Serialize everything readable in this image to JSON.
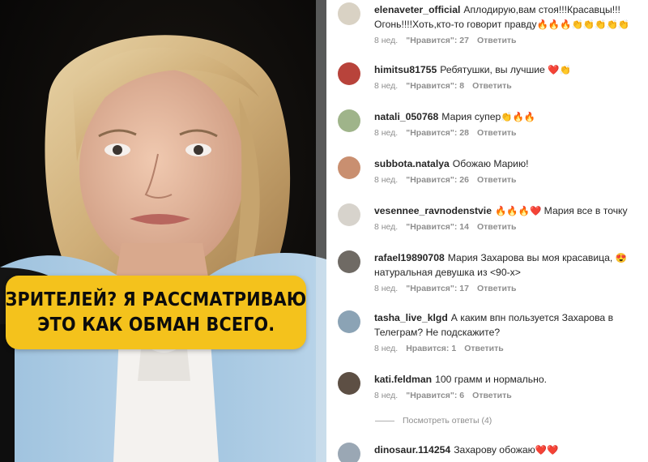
{
  "caption": {
    "line1": "ЗРИТЕЛЕЙ? Я РАССМАТРИВАЮ",
    "line2": "ЭТО КАК ОБМАН ВСЕГО."
  },
  "comments": [
    {
      "username": "elenaveter_official",
      "text": "Аплодирую,вам стоя!!!Красавцы!!! Огонь!!!!Хоть,кто-то говорит правду",
      "emoji": "🔥🔥🔥👏👏👏👏👏",
      "time": "8 нед.",
      "likes": "\"Нравится\": 27",
      "reply": "Ответить",
      "avatar_color": "#d9d2c4"
    },
    {
      "username": "himitsu81755",
      "text": "Ребятушки, вы лучшие",
      "emoji": "❤️👏",
      "time": "8 нед.",
      "likes": "\"Нравится\": 8",
      "reply": "Ответить",
      "avatar_color": "#b8433b"
    },
    {
      "username": "natali_050768",
      "text": "Мария супер",
      "emoji": "👏🔥🔥",
      "time": "8 нед.",
      "likes": "\"Нравится\": 28",
      "reply": "Ответить",
      "avatar_color": "#9fb48a"
    },
    {
      "username": "subbota.natalya",
      "text": "Обожаю Марию!",
      "emoji": "",
      "time": "8 нед.",
      "likes": "\"Нравится\": 26",
      "reply": "Ответить",
      "avatar_color": "#c98f70"
    },
    {
      "username": "vesennee_ravnodenstvie",
      "text": "Мария все в точку",
      "emoji": "🔥🔥🔥❤️",
      "time": "8 нед.",
      "likes": "\"Нравится\": 14",
      "reply": "Ответить",
      "avatar_color": "#d7d3cc"
    },
    {
      "username": "rafael19890708",
      "text": "Мария Захарова вы моя красавица,",
      "emoji": "😍",
      "text2": "натуральная девушка из <90-х>",
      "time": "8 нед.",
      "likes": "\"Нравится\": 17",
      "reply": "Ответить",
      "avatar_color": "#6f6a64"
    },
    {
      "username": "tasha_live_klgd",
      "text": "А каким впн пользуется Захарова в Телеграм? Не подскажите?",
      "emoji": "",
      "time": "8 нед.",
      "likes": "Нравится: 1",
      "reply": "Ответить",
      "avatar_color": "#8ba3b5"
    },
    {
      "username": "kati.feldman",
      "text": "100 грамм и нормально.",
      "emoji": "",
      "time": "8 нед.",
      "likes": "\"Нравится\": 6",
      "reply": "Ответить",
      "avatar_color": "#5d4f44"
    },
    {
      "username": "dinosaur.114254",
      "text": "Захарову обожаю",
      "emoji": "❤️❤️",
      "time": "",
      "likes": "",
      "reply": "",
      "avatar_color": "#9aa7b4"
    }
  ],
  "view_replies": "Посмотреть ответы (4)"
}
